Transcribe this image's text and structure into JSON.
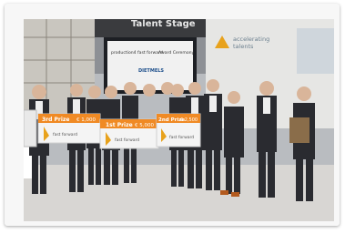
{
  "photo": {
    "description_free": true,
    "booth_banner": "Talent Stage",
    "logo_text_1": "accelerating",
    "logo_text_2": "talents",
    "screen_title": "production4 fast forward",
    "screen_subtitle": "Award Ceremony",
    "screen_logo": "DIETMELS",
    "prizes": [
      {
        "label": "3rd Prize",
        "amount": "€ 1,000",
        "sign_text": "fast forward"
      },
      {
        "label": "1st Prize",
        "amount": "€ 5,000",
        "sign_text": "fast forward"
      },
      {
        "label": "2nd Prize",
        "amount": "€ 2,500",
        "sign_text": "fast forward"
      }
    ],
    "accent_color": "#e07b1a",
    "sign_orange": "#f08a24"
  }
}
